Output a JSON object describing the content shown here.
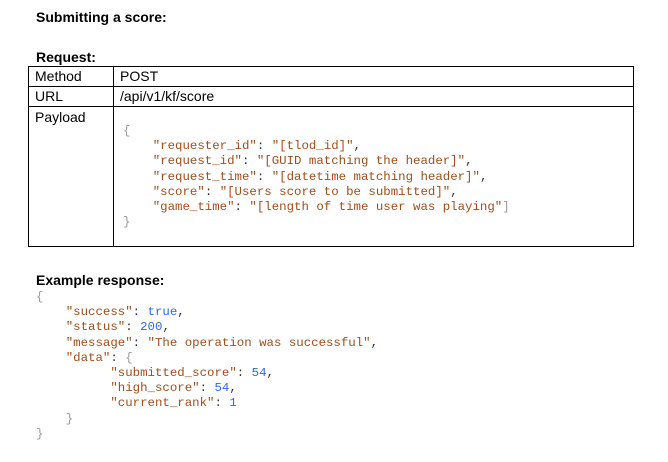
{
  "title": "Submitting a score:",
  "request_heading": "Request:",
  "request_table": {
    "method_label": "Method",
    "method_value": "POST",
    "url_label": "URL",
    "url_value": "/api/v1/kf/score",
    "payload_label": "Payload"
  },
  "payload": {
    "open": "{",
    "close": "}",
    "lines": [
      {
        "key": "\"requester_id\"",
        "value": "\"[tlod_id]\"",
        "trail": ","
      },
      {
        "key": "\"request_id\"",
        "value": "\"[GUID matching the header]\"",
        "trail": ","
      },
      {
        "key": "\"request_time\"",
        "value": "\"[datetime matching header]\"",
        "trail": ","
      },
      {
        "key": "\"score\"",
        "value": "\"[Users score to be submitted]\"",
        "trail": ","
      },
      {
        "key": "\"game_time\"",
        "value": "\"[length of time user was playing\"",
        "trail": "]"
      }
    ]
  },
  "response_heading": "Example response:",
  "response": {
    "open": "{",
    "close": "}",
    "success_key": "\"success\"",
    "success_val": "true",
    "status_key": "\"status\"",
    "status_val": "200",
    "message_key": "\"message\"",
    "message_val": "\"The operation was successful\"",
    "data_key": "\"data\"",
    "data_open": "{",
    "data_close": "}",
    "submitted_key": "\"submitted_score\"",
    "submitted_val": "54",
    "high_key": "\"high_score\"",
    "high_val": "54",
    "rank_key": "\"current_rank\"",
    "rank_val": "1"
  }
}
